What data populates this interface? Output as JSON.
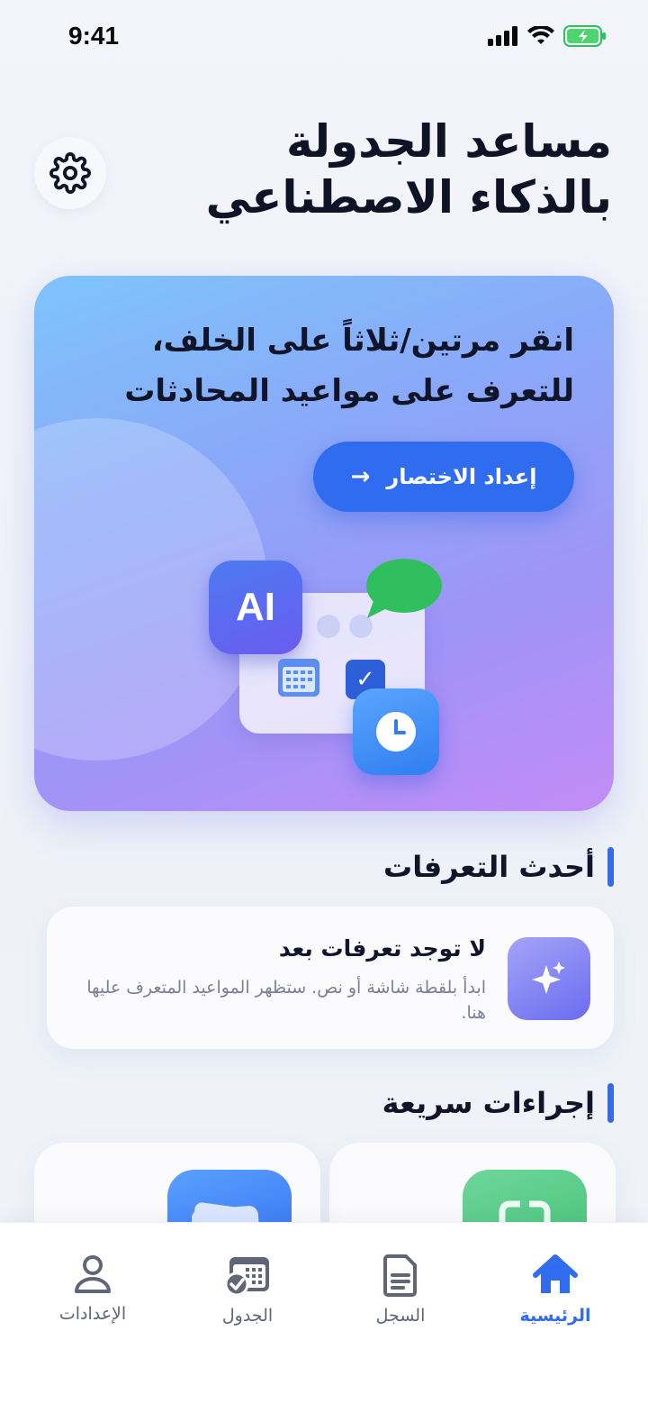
{
  "status_bar": {
    "time": "9:41"
  },
  "header": {
    "title_line1": "مساعد الجدولة",
    "title_line2": "بالذكاء الاصطناعي"
  },
  "hero": {
    "text_line1": "انقر مرتين/ثلاثاً على الخلف،",
    "text_line2": "للتعرف على مواعيد المحادثات",
    "cta_label": "إعداد الاختصار",
    "cta_arrow": "→",
    "ai_badge": "AI"
  },
  "recent": {
    "section_title": "أحدث التعرفات",
    "empty_title": "لا توجد تعرفات بعد",
    "empty_desc": "ابدأ بلقطة شاشة أو نص. ستظهر المواعيد المتعرف عليها هنا."
  },
  "quick_actions": {
    "section_title": "إجراءات سريعة"
  },
  "tabbar": {
    "tabs": [
      {
        "label": "الرئيسية",
        "icon": "home-icon",
        "active": true
      },
      {
        "label": "السجل",
        "icon": "document-icon",
        "active": false
      },
      {
        "label": "الجدول",
        "icon": "calendar-check-icon",
        "active": false
      },
      {
        "label": "الإعدادات",
        "icon": "person-icon",
        "active": false
      }
    ]
  },
  "colors": {
    "accent": "#2f6cf0",
    "message_green": "#2fbf5e"
  }
}
